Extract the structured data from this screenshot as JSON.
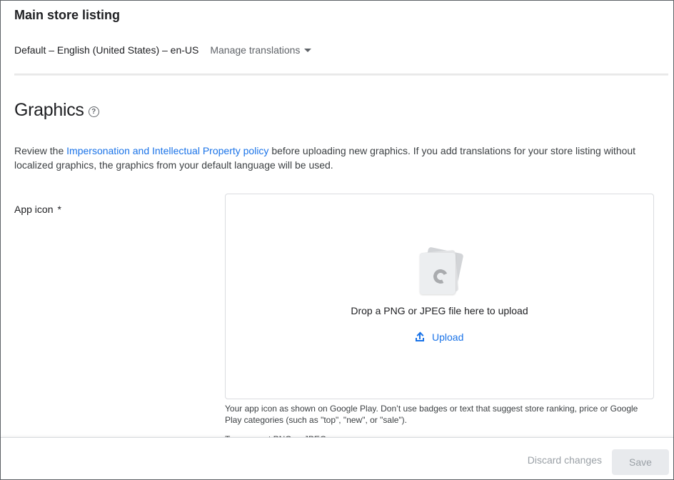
{
  "header": {
    "title": "Main store listing",
    "language_label": "Default – English (United States) – en-US",
    "manage_translations": "Manage translations"
  },
  "graphics": {
    "title": "Graphics",
    "help_glyph": "?",
    "review_prefix": "Review the ",
    "policy_link": "Impersonation and Intellectual Property policy",
    "review_suffix": " before uploading new graphics. If you add translations for your store listing without localized graphics, the graphics from your default language will be used."
  },
  "app_icon": {
    "label": "App icon",
    "required_marker": "*",
    "drop_text": "Drop a PNG or JPEG file here to upload",
    "upload_label": "Upload",
    "helper": "Your app icon as shown on Google Play. Don’t use badges or text that suggest store ranking, price or Google Play categories (such as \"top\", \"new\", or \"sale\").",
    "helper_2": "Transparent PNG or JPEG"
  },
  "footer": {
    "discard_label": "Discard changes",
    "save_label": "Save"
  },
  "colors": {
    "link": "#1a73e8",
    "text": "#202124",
    "disabled": "#9aa0a6"
  }
}
